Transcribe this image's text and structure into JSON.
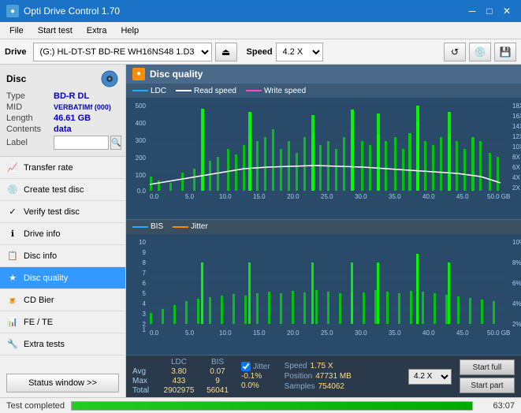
{
  "titlebar": {
    "title": "Opti Drive Control 1.70",
    "icon": "●",
    "minimize": "─",
    "maximize": "□",
    "close": "✕"
  },
  "menubar": {
    "items": [
      "File",
      "Start test",
      "Extra",
      "Help"
    ]
  },
  "toolbar": {
    "drive_label": "Drive",
    "drive_value": "(G:)  HL-DT-ST BD-RE  WH16NS48 1.D3",
    "eject_icon": "⏏",
    "speed_label": "Speed",
    "speed_value": "4.2 X",
    "btn1": "↺",
    "btn2": "💿",
    "btn3": "💾"
  },
  "disc": {
    "title": "Disc",
    "type_label": "Type",
    "type_value": "BD-R DL",
    "mid_label": "MID",
    "mid_value": "VERBATIMf (000)",
    "length_label": "Length",
    "length_value": "46.61 GB",
    "contents_label": "Contents",
    "contents_value": "data",
    "label_label": "Label",
    "label_value": ""
  },
  "nav": {
    "items": [
      {
        "id": "transfer-rate",
        "label": "Transfer rate",
        "icon": "📈"
      },
      {
        "id": "create-test-disc",
        "label": "Create test disc",
        "icon": "💿"
      },
      {
        "id": "verify-test-disc",
        "label": "Verify test disc",
        "icon": "✓"
      },
      {
        "id": "drive-info",
        "label": "Drive info",
        "icon": "ℹ"
      },
      {
        "id": "disc-info",
        "label": "Disc info",
        "icon": "📋"
      },
      {
        "id": "disc-quality",
        "label": "Disc quality",
        "icon": "★",
        "active": true
      },
      {
        "id": "cd-bier",
        "label": "CD Bier",
        "icon": "🍺"
      },
      {
        "id": "fe-te",
        "label": "FE / TE",
        "icon": "📊"
      },
      {
        "id": "extra-tests",
        "label": "Extra tests",
        "icon": "🔧"
      }
    ],
    "status_btn": "Status window >>"
  },
  "disc_quality": {
    "title": "Disc quality",
    "legend": {
      "ldc": "LDC",
      "read_speed": "Read speed",
      "write_speed": "Write speed"
    },
    "chart_top": {
      "y_labels": [
        "500",
        "400",
        "300",
        "200",
        "100",
        "0.0"
      ],
      "x_labels": [
        "0.0",
        "5.0",
        "10.0",
        "15.0",
        "20.0",
        "25.0",
        "30.0",
        "35.0",
        "40.0",
        "45.0",
        "50.0 GB"
      ],
      "y_right_labels": [
        "18X",
        "16X",
        "14X",
        "12X",
        "10X",
        "8X",
        "6X",
        "4X",
        "2X"
      ]
    },
    "chart_bottom": {
      "legend": {
        "bis": "BIS",
        "jitter": "Jitter"
      },
      "y_labels": [
        "10",
        "9",
        "8",
        "7",
        "6",
        "5",
        "4",
        "3",
        "2",
        "1"
      ],
      "x_labels": [
        "0.0",
        "5.0",
        "10.0",
        "15.0",
        "20.0",
        "25.0",
        "30.0",
        "35.0",
        "40.0",
        "45.0",
        "50.0 GB"
      ],
      "y_right_labels": [
        "10%",
        "8%",
        "6%",
        "4%",
        "2%"
      ]
    },
    "stats": {
      "headers": [
        "",
        "LDC",
        "BIS",
        "",
        "Jitter",
        "Speed",
        "",
        ""
      ],
      "avg_label": "Avg",
      "avg_ldc": "3.80",
      "avg_bis": "0.07",
      "avg_jitter": "-0.1%",
      "max_label": "Max",
      "max_ldc": "433",
      "max_bis": "9",
      "max_jitter": "0.0%",
      "total_label": "Total",
      "total_ldc": "2902975",
      "total_bis": "56041",
      "speed_label": "Speed",
      "speed_value": "1.75 X",
      "speed_select": "4.2 X",
      "position_label": "Position",
      "position_value": "47731 MB",
      "samples_label": "Samples",
      "samples_value": "754062",
      "jitter_checked": true,
      "jitter_label": "Jitter",
      "btn_start_full": "Start full",
      "btn_start_part": "Start part"
    }
  },
  "statusbar": {
    "text": "Test completed",
    "progress": 100,
    "time": "63:07"
  }
}
